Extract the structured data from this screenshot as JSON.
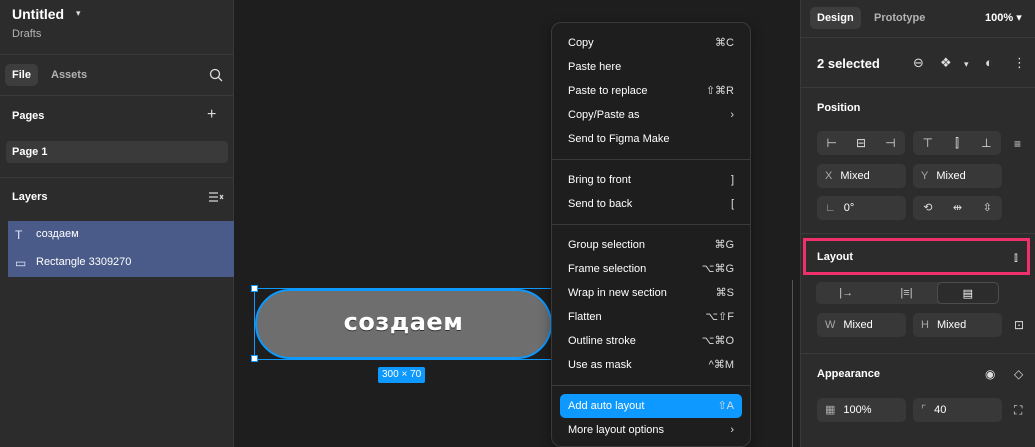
{
  "file": {
    "title": "Untitled",
    "location": "Drafts"
  },
  "left_tabs": {
    "file": "File",
    "assets": "Assets"
  },
  "pages": {
    "heading": "Pages",
    "items": [
      "Page 1"
    ]
  },
  "layers": {
    "heading": "Layers",
    "items": [
      {
        "icon": "T",
        "label": "создаем"
      },
      {
        "icon": "▭",
        "label": "Rectangle 3309270"
      }
    ]
  },
  "canvas": {
    "pill_text": "создаем",
    "size_badge": "300 × 70"
  },
  "menu": {
    "items": [
      {
        "label": "Copy",
        "shortcut": "⌘C"
      },
      {
        "label": "Paste here",
        "shortcut": ""
      },
      {
        "label": "Paste to replace",
        "shortcut": "⇧⌘R"
      },
      {
        "label": "Copy/Paste as",
        "shortcut": "›"
      },
      {
        "label": "Send to Figma Make",
        "shortcut": ""
      },
      {
        "label": "Bring to front",
        "shortcut": "]"
      },
      {
        "label": "Send to back",
        "shortcut": "["
      },
      {
        "label": "Group selection",
        "shortcut": "⌘G"
      },
      {
        "label": "Frame selection",
        "shortcut": "⌥⌘G"
      },
      {
        "label": "Wrap in new section",
        "shortcut": "⌘S"
      },
      {
        "label": "Flatten",
        "shortcut": "⌥⇧F"
      },
      {
        "label": "Outline stroke",
        "shortcut": "⌥⌘O"
      },
      {
        "label": "Use as mask",
        "shortcut": "^⌘M"
      },
      {
        "label": "Add auto layout",
        "shortcut": "⇧A"
      },
      {
        "label": "More layout options",
        "shortcut": "›"
      }
    ]
  },
  "right": {
    "tabs": {
      "design": "Design",
      "prototype": "Prototype"
    },
    "zoom": "100%",
    "selection": "2 selected",
    "position": {
      "heading": "Position",
      "x_label": "X",
      "x_value": "Mixed",
      "y_label": "Y",
      "y_value": "Mixed",
      "rotation": "0°"
    },
    "layout": {
      "heading": "Layout",
      "w_label": "W",
      "w_value": "Mixed",
      "h_label": "H",
      "h_value": "Mixed"
    },
    "appearance": {
      "heading": "Appearance",
      "opacity": "100%",
      "radius": "40"
    }
  },
  "colors": {
    "accent": "#0d99ff",
    "highlight": "#f0306a",
    "layer_selected": "#4a5b8a"
  }
}
